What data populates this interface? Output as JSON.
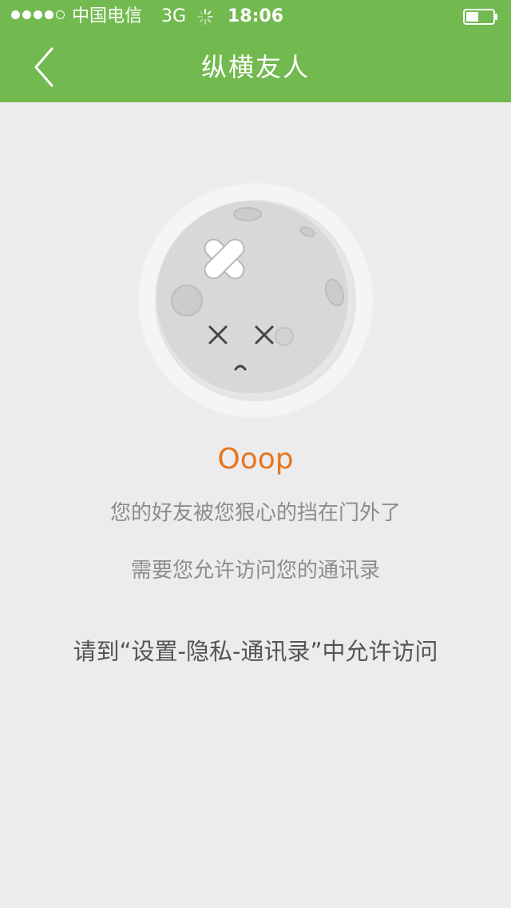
{
  "status_bar": {
    "carrier": "中国电信",
    "network": "3G",
    "time": "18:06",
    "signal_icon": "signal-dots-icon",
    "activity_icon": "spinner-icon",
    "battery_icon": "battery-icon"
  },
  "nav": {
    "title": "纵横友人",
    "back_icon": "chevron-left-icon"
  },
  "content": {
    "illustration": "injured-moon-icon",
    "headline": "Ooop",
    "message_line1": "您的好友被您狠心的挡在门外了",
    "message_line2": "需要您允许访问您的通讯录",
    "instruction": "请到“设置-隐私-通讯录”中允许访问"
  },
  "colors": {
    "header_bg": "#72b94f",
    "page_bg": "#ececee",
    "headline": "#e8761e",
    "muted_text": "#8c8c8c",
    "dark_text": "#555555"
  }
}
